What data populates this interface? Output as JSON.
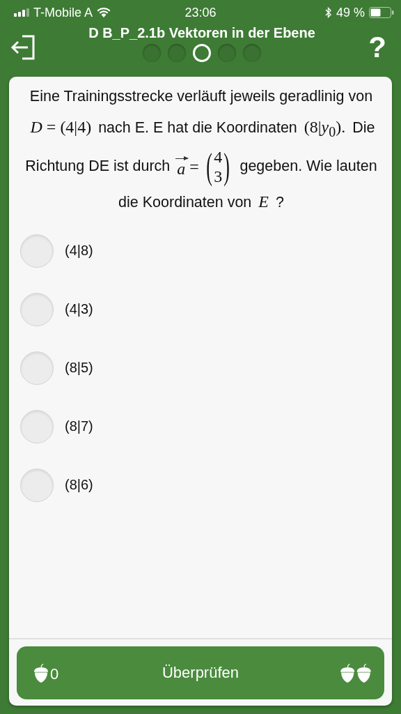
{
  "status_bar": {
    "carrier": "T-Mobile A",
    "time": "23:06",
    "battery": "49 %"
  },
  "header": {
    "title": "D B_P_2.1b Vektoren in der Ebene",
    "help": "?",
    "steps": [
      {
        "selected": false
      },
      {
        "selected": false
      },
      {
        "selected": true
      },
      {
        "selected": false
      },
      {
        "selected": false
      }
    ]
  },
  "question": [
    {
      "kind": "text",
      "text": "Eine Trainingsstrecke verläuft jeweils geradlinig von "
    },
    {
      "kind": "math",
      "text": "*D* = (4|4)"
    },
    {
      "kind": "text",
      "text": " nach E. E hat die Koordinaten "
    },
    {
      "kind": "math",
      "text": "(8|*y*$_{0}$)."
    },
    {
      "kind": "text",
      "text": " Die Richtung DE ist durch "
    },
    {
      "kind": "vector",
      "name": "a",
      "equals": "=",
      "open": "(",
      "close": ")",
      "values": [
        "4",
        "3"
      ]
    },
    {
      "kind": "text",
      "text": " gegeben. Wie lauten die Koordinaten von "
    },
    {
      "kind": "math",
      "text": "*E*"
    },
    {
      "kind": "text",
      "text": " ?"
    }
  ],
  "options": [
    {
      "label": "(4|8)",
      "selected": false
    },
    {
      "label": "(4|3)",
      "selected": false
    },
    {
      "label": "(8|5)",
      "selected": false
    },
    {
      "label": "(8|7)",
      "selected": false
    },
    {
      "label": "(8|6)",
      "selected": false
    }
  ],
  "footer": {
    "score": "0",
    "button": "Überprüfen"
  }
}
